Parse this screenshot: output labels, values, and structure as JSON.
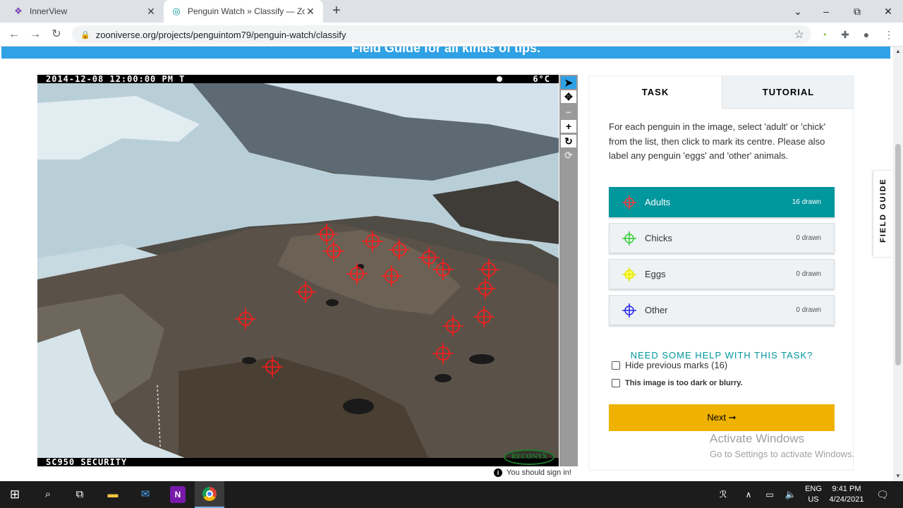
{
  "browser": {
    "tabs": [
      {
        "title": "InnerView",
        "active": false
      },
      {
        "title": "Penguin Watch » Classify — Zoo",
        "active": true
      }
    ],
    "new_tab": "+",
    "url": "zooniverse.org/projects/penguintom79/penguin-watch/classify",
    "window_controls": {
      "minimize": "–",
      "maximize": "⧉",
      "close": "✕"
    }
  },
  "page": {
    "banner": "Field Guide for all kinds of tips.",
    "camera": {
      "timestamp": "2014-12-08 12:00:00 PM  T",
      "temperature": "6°C",
      "model": "SC950 SECURITY",
      "logo": "RECONYX"
    },
    "image_tools": {
      "pointer": "➤",
      "pan": "✥",
      "zoom_out": "−",
      "zoom_in": "+",
      "rotate": "↻",
      "reset": "⟳"
    },
    "sign_in_notice": "You should sign in!",
    "panel": {
      "tabs": {
        "task": "TASK",
        "tutorial": "TUTORIAL"
      },
      "instructions": "For each penguin in the image, select 'adult' or 'chick' from the list, then click to mark its centre. Please also label any penguin 'eggs' and 'other' animals.",
      "tools": [
        {
          "label": "Adults",
          "count": "16 drawn",
          "color": "#ff0000",
          "selected": true
        },
        {
          "label": "Chicks",
          "count": "0 drawn",
          "color": "#33cc33",
          "selected": false
        },
        {
          "label": "Eggs",
          "count": "0 drawn",
          "color": "#ffff00",
          "selected": false
        },
        {
          "label": "Other",
          "count": "0 drawn",
          "color": "#0000ff",
          "selected": false
        }
      ],
      "help_link": "NEED SOME HELP WITH THIS TASK?",
      "hide_marks": "Hide previous marks (16)",
      "too_dark": "This image is too dark or blurry.",
      "next_button": "Next ➞"
    },
    "field_guide_tab": "FIELD GUIDE",
    "watermark": {
      "line1": "Activate Windows",
      "line2": "Go to Settings to activate Windows."
    }
  },
  "taskbar": {
    "language": "ENG",
    "region": "US",
    "time": "9:41 PM",
    "date": "4/24/2021"
  },
  "colors": {
    "accent_teal": "#00979d",
    "next_yellow": "#f0b200",
    "banner_blue": "#2fa1e4",
    "mark_red": "#ff0000"
  }
}
